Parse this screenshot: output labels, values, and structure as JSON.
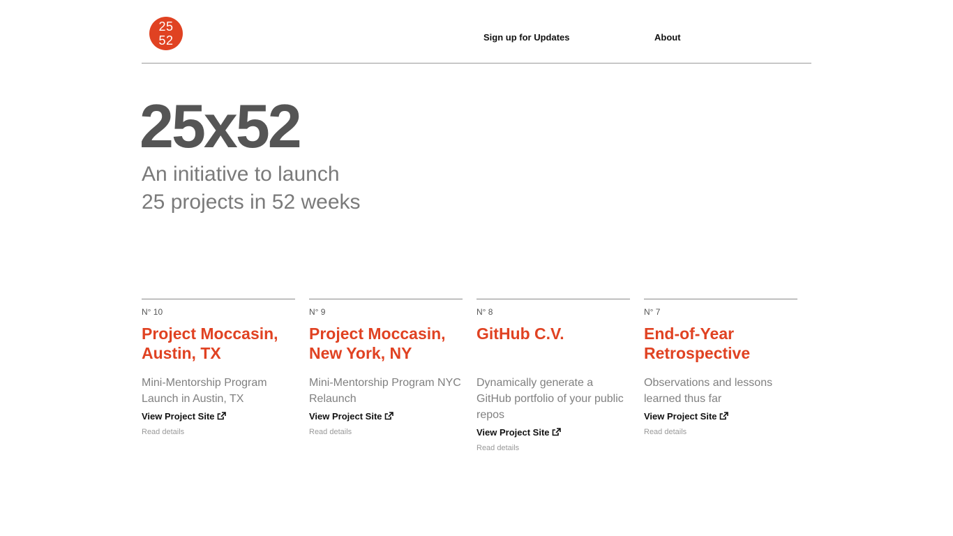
{
  "header": {
    "logo_top": "25",
    "logo_bottom": "52",
    "nav": [
      {
        "label": "Sign up for Updates"
      },
      {
        "label": "About"
      }
    ]
  },
  "hero": {
    "title": "25x52",
    "subtitle_line1": "An initiative to launch",
    "subtitle_line2": "25 projects in 52 weeks"
  },
  "projects": [
    {
      "number": "N° 10",
      "title": "Project Moccasin, Austin, TX",
      "description": "Mini-Mentorship Program Launch in Austin, TX",
      "site_link": "View Project Site",
      "details_link": "Read details"
    },
    {
      "number": "N° 9",
      "title": "Project Moccasin, New York, NY",
      "description": "Mini-Mentorship Program NYC Relaunch",
      "site_link": "View Project Site",
      "details_link": "Read details"
    },
    {
      "number": "N° 8",
      "title": "GitHub C.V.",
      "description": "Dynamically generate a GitHub portfolio of your public repos",
      "site_link": "View Project Site",
      "details_link": "Read details"
    },
    {
      "number": "N° 7",
      "title": "End-of-Year Retrospective",
      "description": "Observations and lessons learned thus far",
      "site_link": "View Project Site",
      "details_link": "Read details"
    }
  ],
  "colors": {
    "accent": "#e04222",
    "hero_title": "#555555",
    "muted_text": "#808080"
  },
  "icons": [
    "external-link-icon"
  ]
}
